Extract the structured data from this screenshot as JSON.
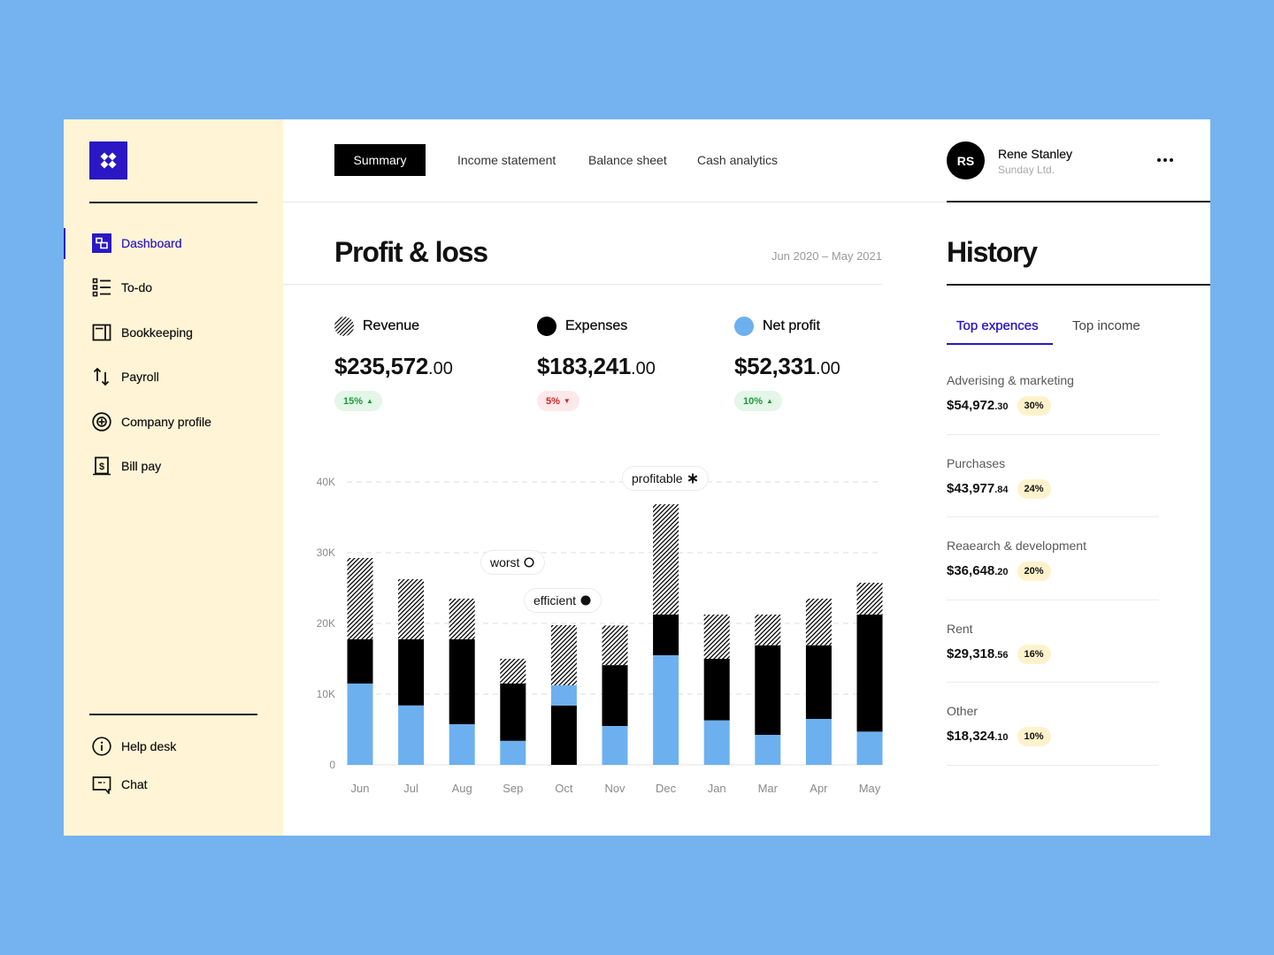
{
  "app": {
    "logo_icon": "four-diamonds-logo-icon"
  },
  "sidebar": {
    "items": [
      {
        "label": "Dashboard",
        "icon": "dashboard-icon",
        "active": true
      },
      {
        "label": "To-do",
        "icon": "checklist-icon",
        "active": false
      },
      {
        "label": "Bookkeeping",
        "icon": "book-icon",
        "active": false
      },
      {
        "label": "Payroll",
        "icon": "transfer-arrows-icon",
        "active": false
      },
      {
        "label": "Company profile",
        "icon": "circle-plus-icon",
        "active": false
      },
      {
        "label": "Bill pay",
        "icon": "dollar-bill-icon",
        "active": false
      }
    ],
    "footer_items": [
      {
        "label": "Help desk",
        "icon": "info-icon"
      },
      {
        "label": "Chat",
        "icon": "chat-icon"
      }
    ]
  },
  "header": {
    "tabs": [
      {
        "label": "Summary",
        "active": true
      },
      {
        "label": "Income statement",
        "active": false
      },
      {
        "label": "Balance sheet",
        "active": false
      },
      {
        "label": "Cash analytics",
        "active": false
      }
    ],
    "user": {
      "initials": "RS",
      "name": "Rene Stanley",
      "company": "Sunday Ltd."
    },
    "more_icon": "ellipsis-icon"
  },
  "main": {
    "title": "Profit & loss",
    "date_range": "Jun 2020 – May 2021",
    "stats": [
      {
        "label": "Revenue",
        "icon": "hatched-circle-icon",
        "amount": "$235,572",
        "cents": ".00",
        "change": "15%",
        "direction": "up",
        "arrow": "▲"
      },
      {
        "label": "Expenses",
        "icon": "black-circle-icon",
        "amount": "$183,241",
        "cents": ".00",
        "change": "5%",
        "direction": "down",
        "arrow": "▼"
      },
      {
        "label": "Net profit",
        "icon": "blue-circle-icon",
        "amount": "$52,331",
        "cents": ".00",
        "change": "10%",
        "direction": "up",
        "arrow": "▲"
      }
    ]
  },
  "chart_data": {
    "type": "bar",
    "stacked": true,
    "title": "",
    "xlabel": "",
    "ylabel": "",
    "categories": [
      "Jun",
      "Jul",
      "Aug",
      "Sep",
      "Oct",
      "Nov",
      "Dec",
      "Jan",
      "Mar",
      "Apr",
      "May"
    ],
    "ylim": [
      0,
      40000
    ],
    "yticks": [
      0,
      10000,
      20000,
      30000,
      40000
    ],
    "ytick_labels": [
      "0",
      "10K",
      "20K",
      "30K",
      "40K"
    ],
    "grid": true,
    "legend": "top (as stat headers)",
    "series": [
      {
        "name": "Net profit",
        "fill": "solid",
        "color": "#6db0ef",
        "values": [
          11500,
          8400,
          5750,
          3400,
          2850,
          5500,
          15500,
          6300,
          4250,
          6500,
          4700
        ]
      },
      {
        "name": "Expenses",
        "fill": "solid",
        "color": "#000000",
        "values": [
          6250,
          9350,
          12000,
          8100,
          8400,
          8600,
          5750,
          8700,
          12650,
          10400,
          16550
        ]
      },
      {
        "name": "Revenue",
        "fill": "hatched",
        "color": "#000000",
        "values": [
          11500,
          8500,
          5750,
          3500,
          8500,
          5600,
          15600,
          6250,
          4350,
          6600,
          4500
        ]
      }
    ],
    "stack_order": [
      "Net profit",
      "Expenses",
      "Revenue"
    ],
    "stack_order_overrides": {
      "Oct": [
        "Expenses",
        "Net profit",
        "Revenue"
      ]
    },
    "annotations": [
      {
        "label": "profitable",
        "marker": "asterisk",
        "category": "Dec"
      },
      {
        "label": "worst",
        "marker": "open-circle",
        "category": "Sep"
      },
      {
        "label": "efficient",
        "marker": "filled-circle",
        "category": "Oct"
      }
    ]
  },
  "history": {
    "title": "History",
    "tabs": [
      {
        "label": "Top expences",
        "active": true
      },
      {
        "label": "Top income",
        "active": false
      }
    ],
    "items": [
      {
        "label": "Adverising & marketing",
        "amount": "$54,972",
        "cents": ".30",
        "percent": "30%"
      },
      {
        "label": "Purchases",
        "amount": "$43,977",
        "cents": ".84",
        "percent": "24%"
      },
      {
        "label": "Reaearch & development",
        "amount": "$36,648",
        "cents": ".20",
        "percent": "20%"
      },
      {
        "label": "Rent",
        "amount": "$29,318",
        "cents": ".56",
        "percent": "16%"
      },
      {
        "label": "Other",
        "amount": "$18,324",
        "cents": ".10",
        "percent": "10%"
      }
    ]
  },
  "colors": {
    "page_background": "#74b3ef",
    "sidebar_background": "#fff5d6",
    "brand": "#2b17c4",
    "net_profit": "#6db0ef",
    "positive": "#1e9a3d",
    "negative": "#d52121",
    "highlight_badge": "#fdf2cc"
  }
}
